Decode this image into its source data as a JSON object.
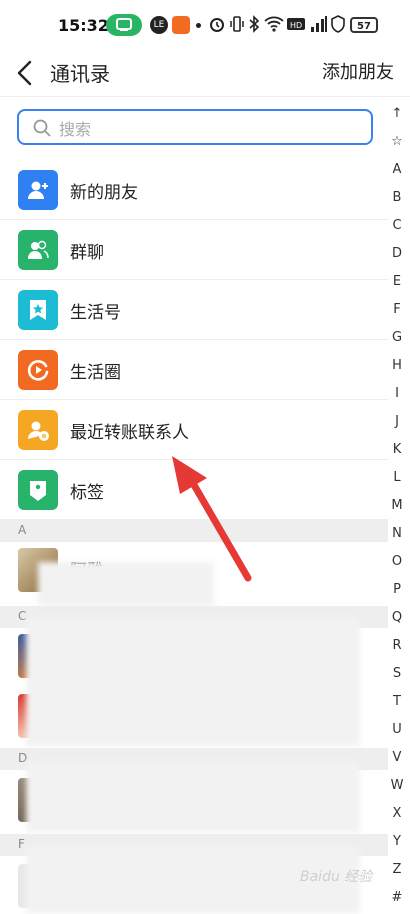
{
  "status_bar": {
    "time": "15:32",
    "app_icon_1": "LE",
    "battery": "57"
  },
  "header": {
    "title": "通讯录",
    "action": "添加朋友"
  },
  "search": {
    "placeholder": "搜索"
  },
  "menu": [
    {
      "label": "新的朋友",
      "icon": "add-friend-icon",
      "color": "#2f80f0"
    },
    {
      "label": "群聊",
      "icon": "group-icon",
      "color": "#27b36a"
    },
    {
      "label": "生活号",
      "icon": "star-badge-icon",
      "color": "#1bbcd4"
    },
    {
      "label": "生活圈",
      "icon": "play-circle-icon",
      "color": "#f26a21"
    },
    {
      "label": "最近转账联系人",
      "icon": "transfer-contact-icon",
      "color": "#f5a623"
    },
    {
      "label": "标签",
      "icon": "tag-icon",
      "color": "#27b36a"
    }
  ],
  "sections": [
    {
      "letter": "A",
      "contacts": [
        {
          "name": "阿雅"
        }
      ]
    },
    {
      "letter": "C",
      "contacts": []
    },
    {
      "letter": "D",
      "contacts": []
    },
    {
      "letter": "F",
      "contacts": []
    }
  ],
  "index_bar": [
    "↑",
    "☆",
    "A",
    "B",
    "C",
    "D",
    "E",
    "F",
    "G",
    "H",
    "I",
    "J",
    "K",
    "L",
    "M",
    "N",
    "O",
    "P",
    "Q",
    "R",
    "S",
    "T",
    "U",
    "V",
    "W",
    "X",
    "Y",
    "Z",
    "#"
  ],
  "watermark": "Baidu 经验"
}
